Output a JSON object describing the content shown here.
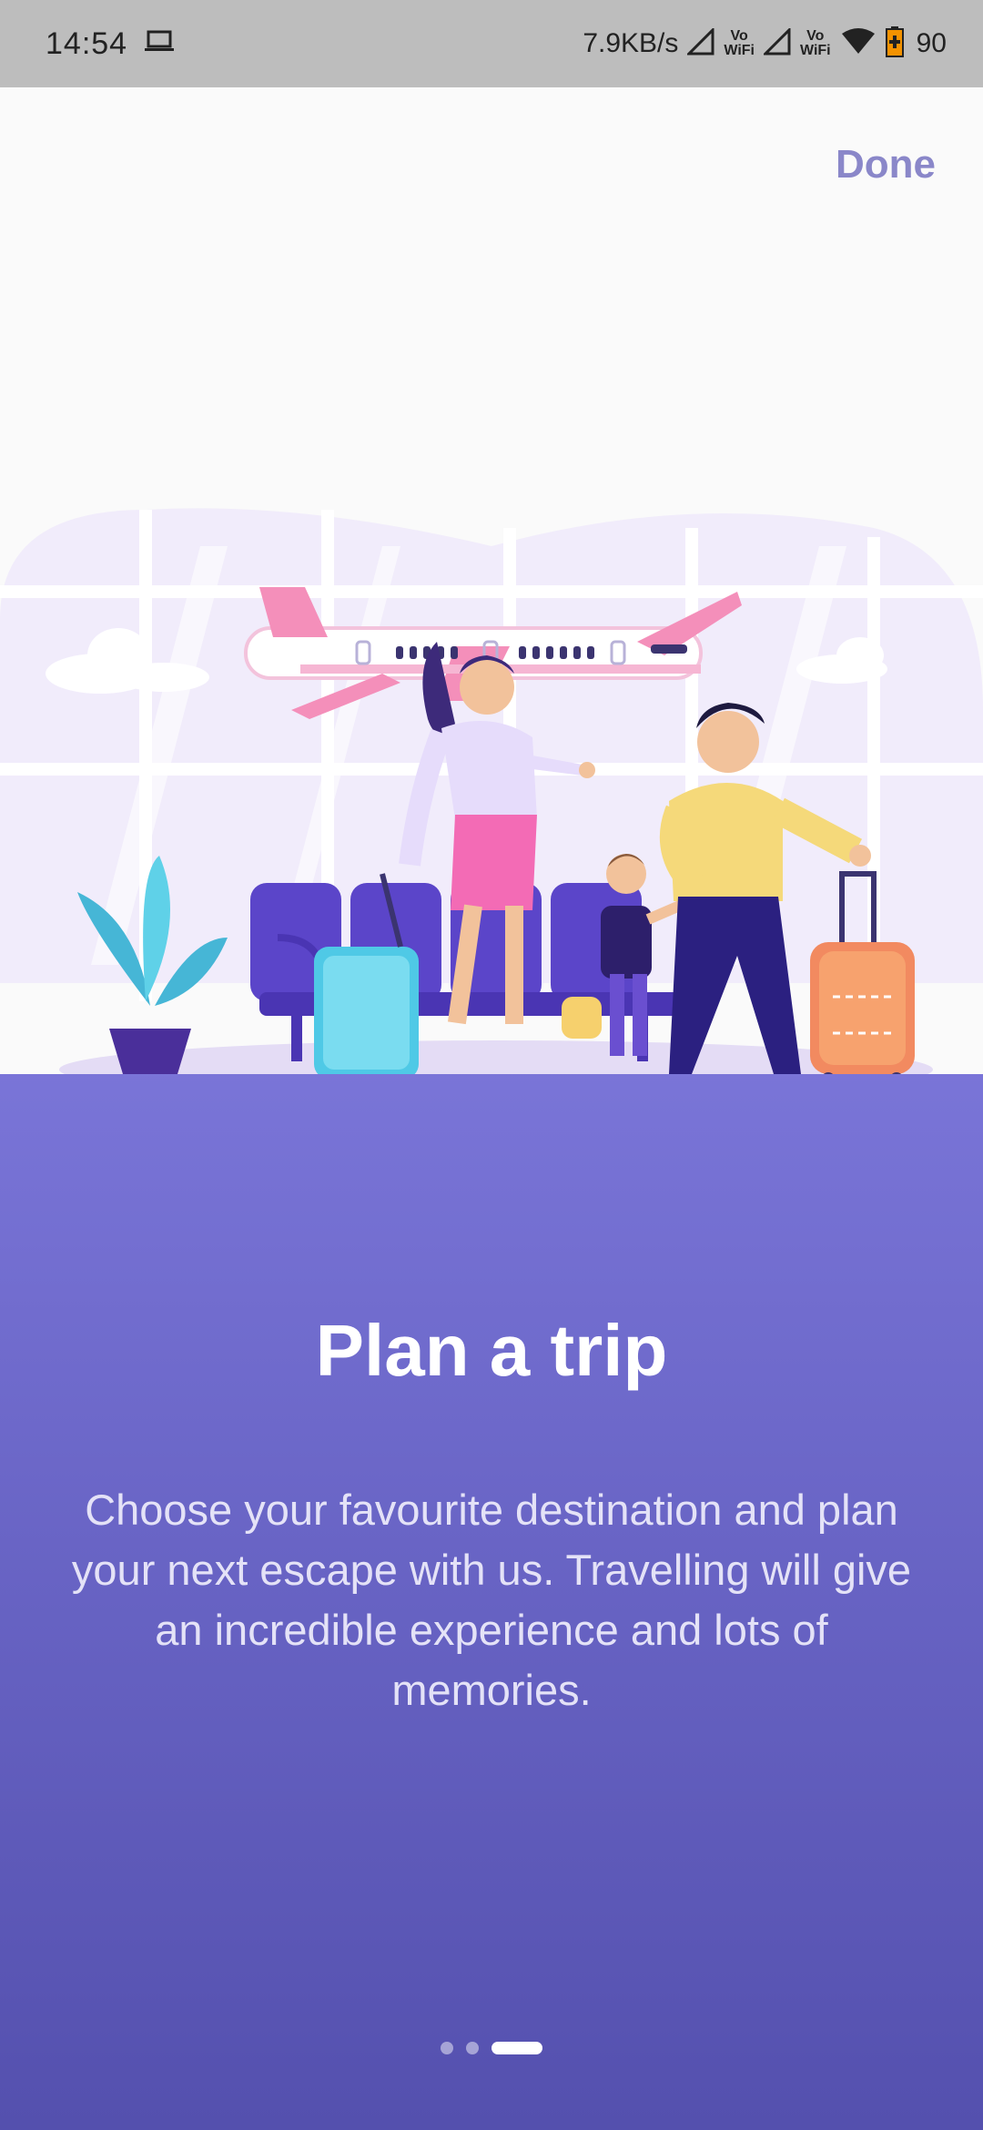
{
  "status_bar": {
    "time": "14:54",
    "net_speed": "7.9KB/s",
    "vowifi_1": "Vo\nWiFi",
    "vowifi_2": "Vo\nWiFi",
    "battery": "90",
    "icons": [
      "laptop-icon",
      "signal-icon",
      "wifi-icon",
      "battery-icon"
    ]
  },
  "onboarding": {
    "done_label": "Done",
    "title": "Plan a trip",
    "description": "Choose your favourite destination and plan your next escape with us. Travelling will give an incredible experience and lots of memories.",
    "page_count": 3,
    "current_page": 3
  },
  "colors": {
    "panel_top": "#7a75d8",
    "panel_bottom": "#5450ae",
    "accent": "#8a87c9",
    "status_bar": "#bdbdbd"
  }
}
